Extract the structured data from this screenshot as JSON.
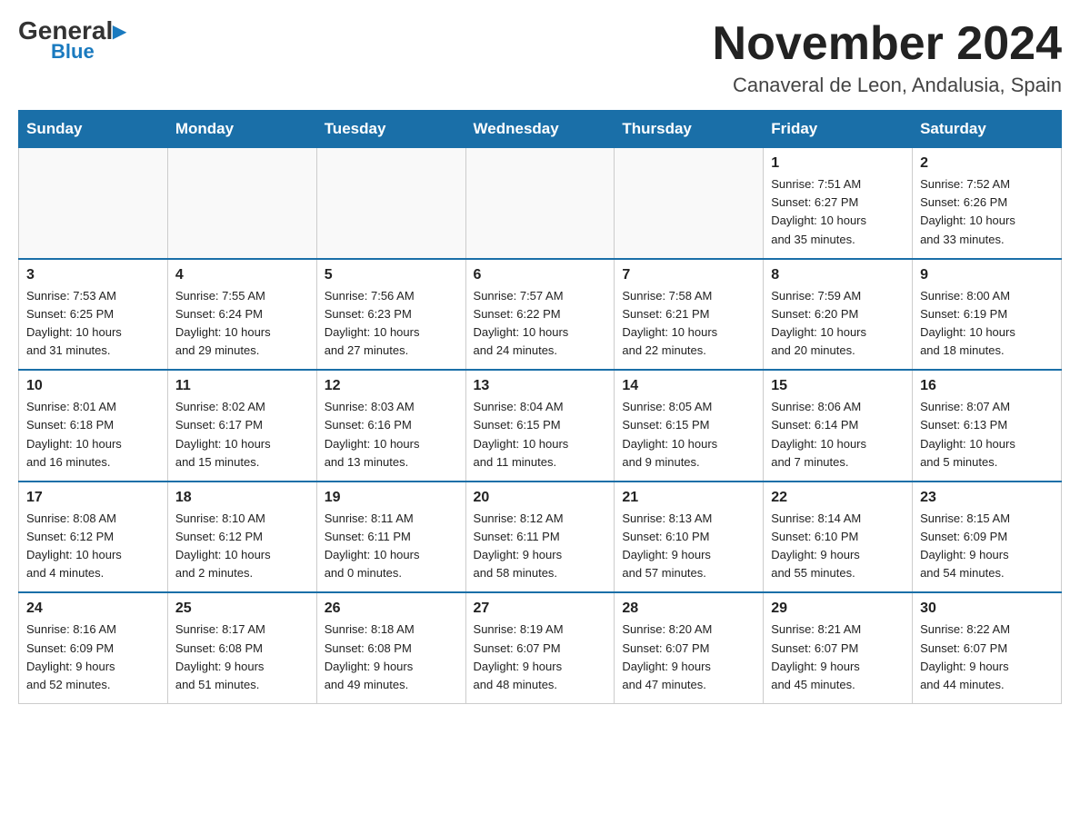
{
  "header": {
    "logo_general": "General",
    "logo_blue": "Blue",
    "month_year": "November 2024",
    "location": "Canaveral de Leon, Andalusia, Spain"
  },
  "days_of_week": [
    "Sunday",
    "Monday",
    "Tuesday",
    "Wednesday",
    "Thursday",
    "Friday",
    "Saturday"
  ],
  "weeks": [
    [
      {
        "day": "",
        "info": ""
      },
      {
        "day": "",
        "info": ""
      },
      {
        "day": "",
        "info": ""
      },
      {
        "day": "",
        "info": ""
      },
      {
        "day": "",
        "info": ""
      },
      {
        "day": "1",
        "info": "Sunrise: 7:51 AM\nSunset: 6:27 PM\nDaylight: 10 hours\nand 35 minutes."
      },
      {
        "day": "2",
        "info": "Sunrise: 7:52 AM\nSunset: 6:26 PM\nDaylight: 10 hours\nand 33 minutes."
      }
    ],
    [
      {
        "day": "3",
        "info": "Sunrise: 7:53 AM\nSunset: 6:25 PM\nDaylight: 10 hours\nand 31 minutes."
      },
      {
        "day": "4",
        "info": "Sunrise: 7:55 AM\nSunset: 6:24 PM\nDaylight: 10 hours\nand 29 minutes."
      },
      {
        "day": "5",
        "info": "Sunrise: 7:56 AM\nSunset: 6:23 PM\nDaylight: 10 hours\nand 27 minutes."
      },
      {
        "day": "6",
        "info": "Sunrise: 7:57 AM\nSunset: 6:22 PM\nDaylight: 10 hours\nand 24 minutes."
      },
      {
        "day": "7",
        "info": "Sunrise: 7:58 AM\nSunset: 6:21 PM\nDaylight: 10 hours\nand 22 minutes."
      },
      {
        "day": "8",
        "info": "Sunrise: 7:59 AM\nSunset: 6:20 PM\nDaylight: 10 hours\nand 20 minutes."
      },
      {
        "day": "9",
        "info": "Sunrise: 8:00 AM\nSunset: 6:19 PM\nDaylight: 10 hours\nand 18 minutes."
      }
    ],
    [
      {
        "day": "10",
        "info": "Sunrise: 8:01 AM\nSunset: 6:18 PM\nDaylight: 10 hours\nand 16 minutes."
      },
      {
        "day": "11",
        "info": "Sunrise: 8:02 AM\nSunset: 6:17 PM\nDaylight: 10 hours\nand 15 minutes."
      },
      {
        "day": "12",
        "info": "Sunrise: 8:03 AM\nSunset: 6:16 PM\nDaylight: 10 hours\nand 13 minutes."
      },
      {
        "day": "13",
        "info": "Sunrise: 8:04 AM\nSunset: 6:15 PM\nDaylight: 10 hours\nand 11 minutes."
      },
      {
        "day": "14",
        "info": "Sunrise: 8:05 AM\nSunset: 6:15 PM\nDaylight: 10 hours\nand 9 minutes."
      },
      {
        "day": "15",
        "info": "Sunrise: 8:06 AM\nSunset: 6:14 PM\nDaylight: 10 hours\nand 7 minutes."
      },
      {
        "day": "16",
        "info": "Sunrise: 8:07 AM\nSunset: 6:13 PM\nDaylight: 10 hours\nand 5 minutes."
      }
    ],
    [
      {
        "day": "17",
        "info": "Sunrise: 8:08 AM\nSunset: 6:12 PM\nDaylight: 10 hours\nand 4 minutes."
      },
      {
        "day": "18",
        "info": "Sunrise: 8:10 AM\nSunset: 6:12 PM\nDaylight: 10 hours\nand 2 minutes."
      },
      {
        "day": "19",
        "info": "Sunrise: 8:11 AM\nSunset: 6:11 PM\nDaylight: 10 hours\nand 0 minutes."
      },
      {
        "day": "20",
        "info": "Sunrise: 8:12 AM\nSunset: 6:11 PM\nDaylight: 9 hours\nand 58 minutes."
      },
      {
        "day": "21",
        "info": "Sunrise: 8:13 AM\nSunset: 6:10 PM\nDaylight: 9 hours\nand 57 minutes."
      },
      {
        "day": "22",
        "info": "Sunrise: 8:14 AM\nSunset: 6:10 PM\nDaylight: 9 hours\nand 55 minutes."
      },
      {
        "day": "23",
        "info": "Sunrise: 8:15 AM\nSunset: 6:09 PM\nDaylight: 9 hours\nand 54 minutes."
      }
    ],
    [
      {
        "day": "24",
        "info": "Sunrise: 8:16 AM\nSunset: 6:09 PM\nDaylight: 9 hours\nand 52 minutes."
      },
      {
        "day": "25",
        "info": "Sunrise: 8:17 AM\nSunset: 6:08 PM\nDaylight: 9 hours\nand 51 minutes."
      },
      {
        "day": "26",
        "info": "Sunrise: 8:18 AM\nSunset: 6:08 PM\nDaylight: 9 hours\nand 49 minutes."
      },
      {
        "day": "27",
        "info": "Sunrise: 8:19 AM\nSunset: 6:07 PM\nDaylight: 9 hours\nand 48 minutes."
      },
      {
        "day": "28",
        "info": "Sunrise: 8:20 AM\nSunset: 6:07 PM\nDaylight: 9 hours\nand 47 minutes."
      },
      {
        "day": "29",
        "info": "Sunrise: 8:21 AM\nSunset: 6:07 PM\nDaylight: 9 hours\nand 45 minutes."
      },
      {
        "day": "30",
        "info": "Sunrise: 8:22 AM\nSunset: 6:07 PM\nDaylight: 9 hours\nand 44 minutes."
      }
    ]
  ]
}
